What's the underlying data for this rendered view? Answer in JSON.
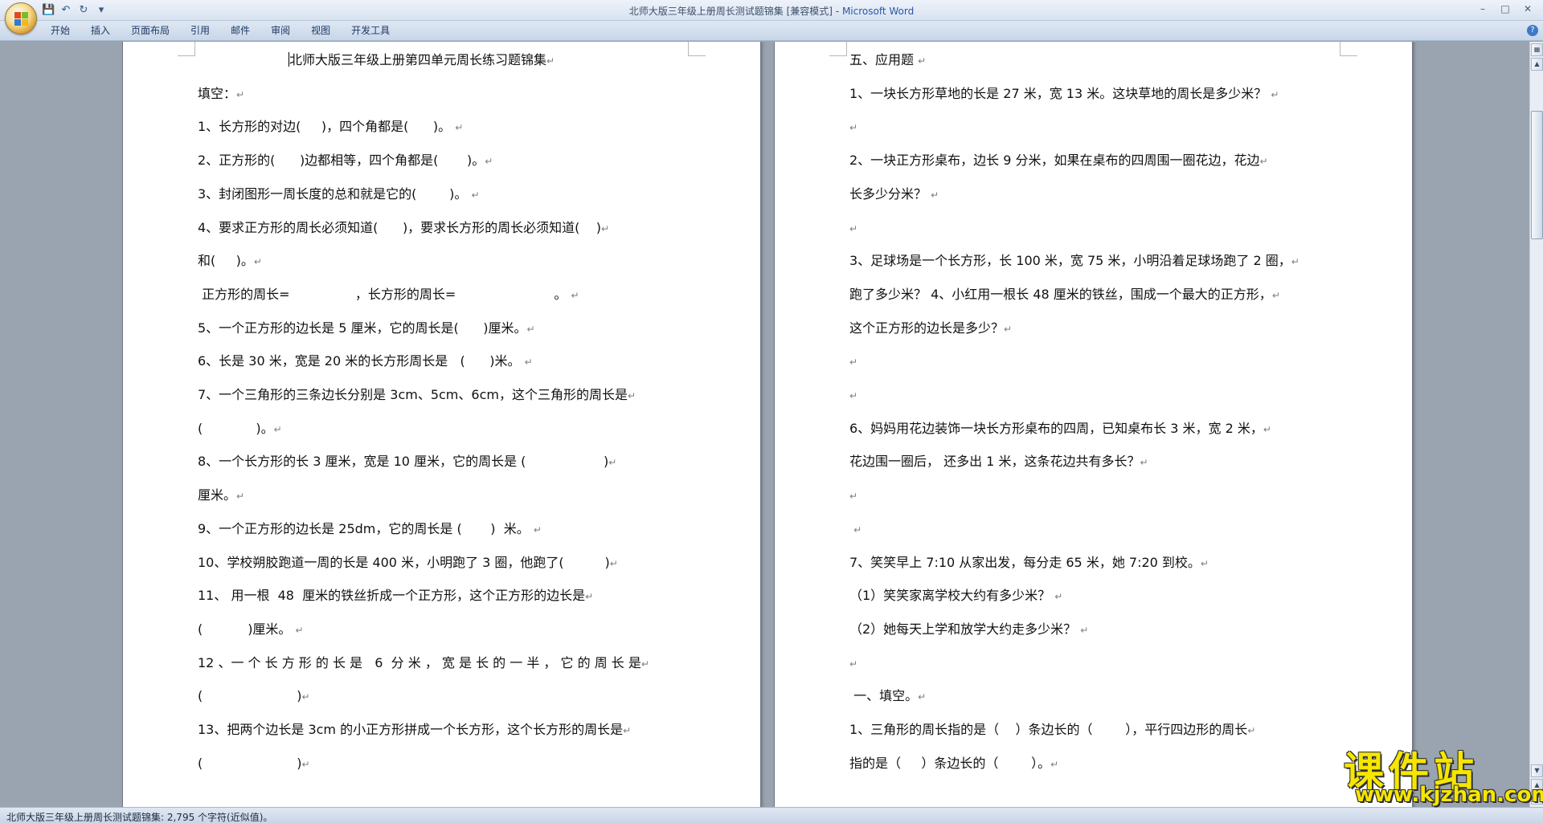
{
  "window": {
    "title_doc": "北师大版三年级上册周长测试题锦集 [兼容模式]",
    "title_sep": " - ",
    "title_app": "Microsoft Word"
  },
  "qat": {
    "save_icon": "save-icon",
    "undo_icon": "undo-icon",
    "redo_icon": "redo-icon"
  },
  "ribbon": {
    "tabs": [
      "开始",
      "插入",
      "页面布局",
      "引用",
      "邮件",
      "审阅",
      "视图",
      "开发工具"
    ]
  },
  "left_page": {
    "lines": [
      "北师大版三年级上册第四单元周长练习题锦集",
      "填空：",
      "1、长方形的对边(     )，四个角都是(      )。 ",
      "2、正方形的(      )边都相等，四个角都是(       )。",
      "3、封闭图形一周长度的总和就是它的(        )。 ",
      "4、要求正方形的周长必须知道(      )，要求长方形的周长必须知道(    )",
      "和(     )。",
      " 正方形的周长=                ，长方形的周长=                        。 ",
      "5、一个正方形的边长是 5 厘米，它的周长是(      )厘米。",
      "6、长是 30 米，宽是 20 米的长方形周长是   (      )米。 ",
      "7、一个三角形的三条边长分别是 3cm、5cm、6cm，这个三角形的周长是",
      "(             )。",
      "8、一个长方形的长 3 厘米，宽是 10 厘米，它的周长是 (                   )",
      "厘米。",
      "9、一个正方形的边长是 25dm，它的周长是 (       )  米。 ",
      "10、学校朔胶跑道一周的长是 400 米，小明跑了 3 圈，他跑了(          )",
      "11、 用一根  48  厘米的铁丝折成一个正方形，这个正方形的边长是",
      "(           )厘米。 ",
      "12 、一 个 长 方 形 的 长 是   6  分 米 ， 宽 是 长 的 一 半 ， 它 的 周 长 是",
      "(                       )",
      "13、把两个边长是 3cm 的小正方形拼成一个长方形，这个长方形的周长是",
      "(                       )"
    ]
  },
  "right_page": {
    "lines": [
      "五、应用题 ",
      "1、一块长方形草地的长是 27 米，宽 13 米。这块草地的周长是多少米？ ",
      "",
      "2、一块正方形桌布，边长 9 分米，如果在桌布的四周围一圈花边，花边",
      "长多少分米？ ",
      "",
      "3、足球场是一个长方形，长 100 米，宽 75 米，小明沿着足球场跑了 2 圈，",
      "跑了多少米？ 4、小红用一根长 48 厘米的铁丝，围成一个最大的正方形，",
      "这个正方形的边长是多少？",
      "",
      "",
      "6、妈妈用花边装饰一块长方形桌布的四周，已知桌布长 3 米，宽 2 米，",
      "花边围一圈后， 还多出 1 米，这条花边共有多长？",
      "",
      " ",
      "7、笑笑早上 7:10 从家出发，每分走 65 米，她 7:20 到校。",
      "（1）笑笑家离学校大约有多少米？ ",
      "（2）她每天上学和放学大约走多少米？ ",
      "",
      " 一、填空。",
      "1、三角形的周长指的是（    ）条边长的（        ），平行四边形的周长",
      "指的是（     ）条边长的（        ）。"
    ]
  },
  "paragraph_mark": "↵",
  "status": {
    "text": "北师大版三年级上册周长测试题锦集: 2,795 个字符(近似值)。"
  },
  "watermark": {
    "cn": "课件站",
    "en": "www.kjzhan.com"
  }
}
